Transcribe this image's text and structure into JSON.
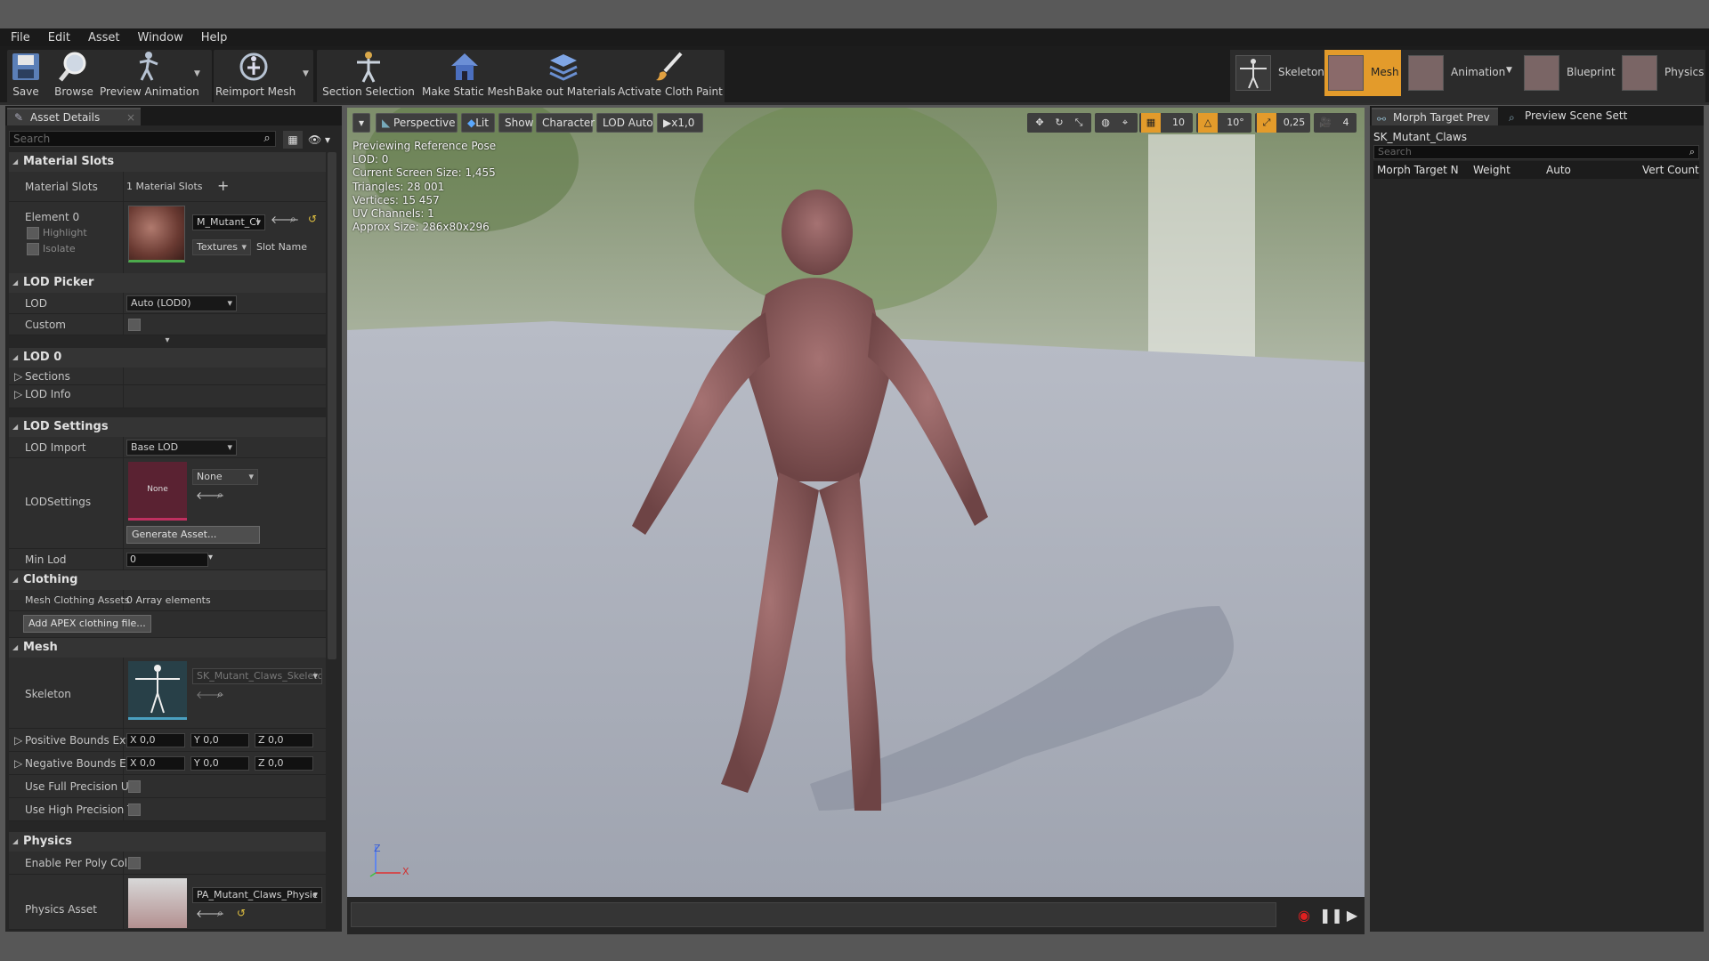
{
  "menu": [
    "File",
    "Edit",
    "Asset",
    "Window",
    "Help"
  ],
  "toolbar": {
    "save": "Save",
    "browse": "Browse",
    "preview_animation": "Preview Animation",
    "reimport_mesh": "Reimport Mesh",
    "section_selection": "Section Selection",
    "make_static_mesh": "Make Static Mesh",
    "bake_out_materials": "Bake out Materials",
    "activate_cloth_paint": "Activate Cloth Paint"
  },
  "modes": {
    "skeleton": "Skeleton",
    "mesh": "Mesh",
    "animation": "Animation",
    "blueprint": "Blueprint",
    "physics": "Physics"
  },
  "details": {
    "tab": "Asset Details",
    "search_placeholder": "Search",
    "material_slots": {
      "header": "Material Slots",
      "label": "Material Slots",
      "count": "1 Material Slots",
      "element": "Element 0",
      "highlight": "Highlight",
      "isolate": "Isolate",
      "material": "M_Mutant_Cl",
      "textures": "Textures",
      "slot_name": "Slot Name"
    },
    "lod_picker": {
      "header": "LOD Picker",
      "lod_label": "LOD",
      "lod_value": "Auto (LOD0)",
      "custom_label": "Custom"
    },
    "lod0": {
      "header": "LOD 0",
      "sections": "Sections",
      "lod_info": "LOD Info"
    },
    "lod_settings": {
      "header": "LOD Settings",
      "lod_import": "LOD Import",
      "lod_import_value": "Base LOD",
      "lod_settings_label": "LODSettings",
      "none_thumb": "None",
      "none_value": "None",
      "generate": "Generate Asset...",
      "min_lod": "Min Lod",
      "min_lod_value": "0"
    },
    "clothing": {
      "header": "Clothing",
      "assets_label": "Mesh Clothing Assets",
      "assets_value": "0 Array elements",
      "add_apex": "Add APEX clothing file..."
    },
    "mesh": {
      "header": "Mesh",
      "skeleton_label": "Skeleton",
      "skeleton_value": "SK_Mutant_Claws_Skeleto",
      "pos_bounds": "Positive Bounds Exte",
      "neg_bounds": "Negative Bounds Ext",
      "x": "X",
      "y": "Y",
      "z": "Z",
      "v": "0,0",
      "full_precision": "Use Full Precision UV",
      "high_precision": "Use High Precision Ta"
    },
    "physics": {
      "header": "Physics",
      "per_poly": "Enable Per Poly Collis",
      "asset_label": "Physics Asset",
      "asset_value": "PA_Mutant_Claws_Physic"
    }
  },
  "viewport": {
    "perspective": "Perspective",
    "lit": "Lit",
    "show": "Show",
    "character": "Character",
    "lod_auto": "LOD Auto",
    "speed": "x1,0",
    "grid_snap": "10",
    "rot_snap": "10°",
    "scale_snap": "0,25",
    "cam_speed": "4",
    "stats": [
      "Previewing Reference Pose",
      "LOD: 0",
      "Current Screen Size: 1,455",
      "Triangles: 28 001",
      "Vertices: 15 457",
      "UV Channels: 1",
      "Approx Size: 286x80x296"
    ],
    "axis_x": "X",
    "axis_z": "Z"
  },
  "right": {
    "tab_morph": "Morph Target Prev",
    "tab_preview": "Preview Scene Sett",
    "mesh_name": "SK_Mutant_Claws",
    "search_placeholder": "Search",
    "col_name": "Morph Target N",
    "col_weight": "Weight",
    "col_auto": "Auto",
    "col_vert": "Vert Count"
  },
  "colors": {
    "accent": "#e39b2b",
    "panel": "#262626",
    "viewport_floor": "#a8adb8"
  }
}
